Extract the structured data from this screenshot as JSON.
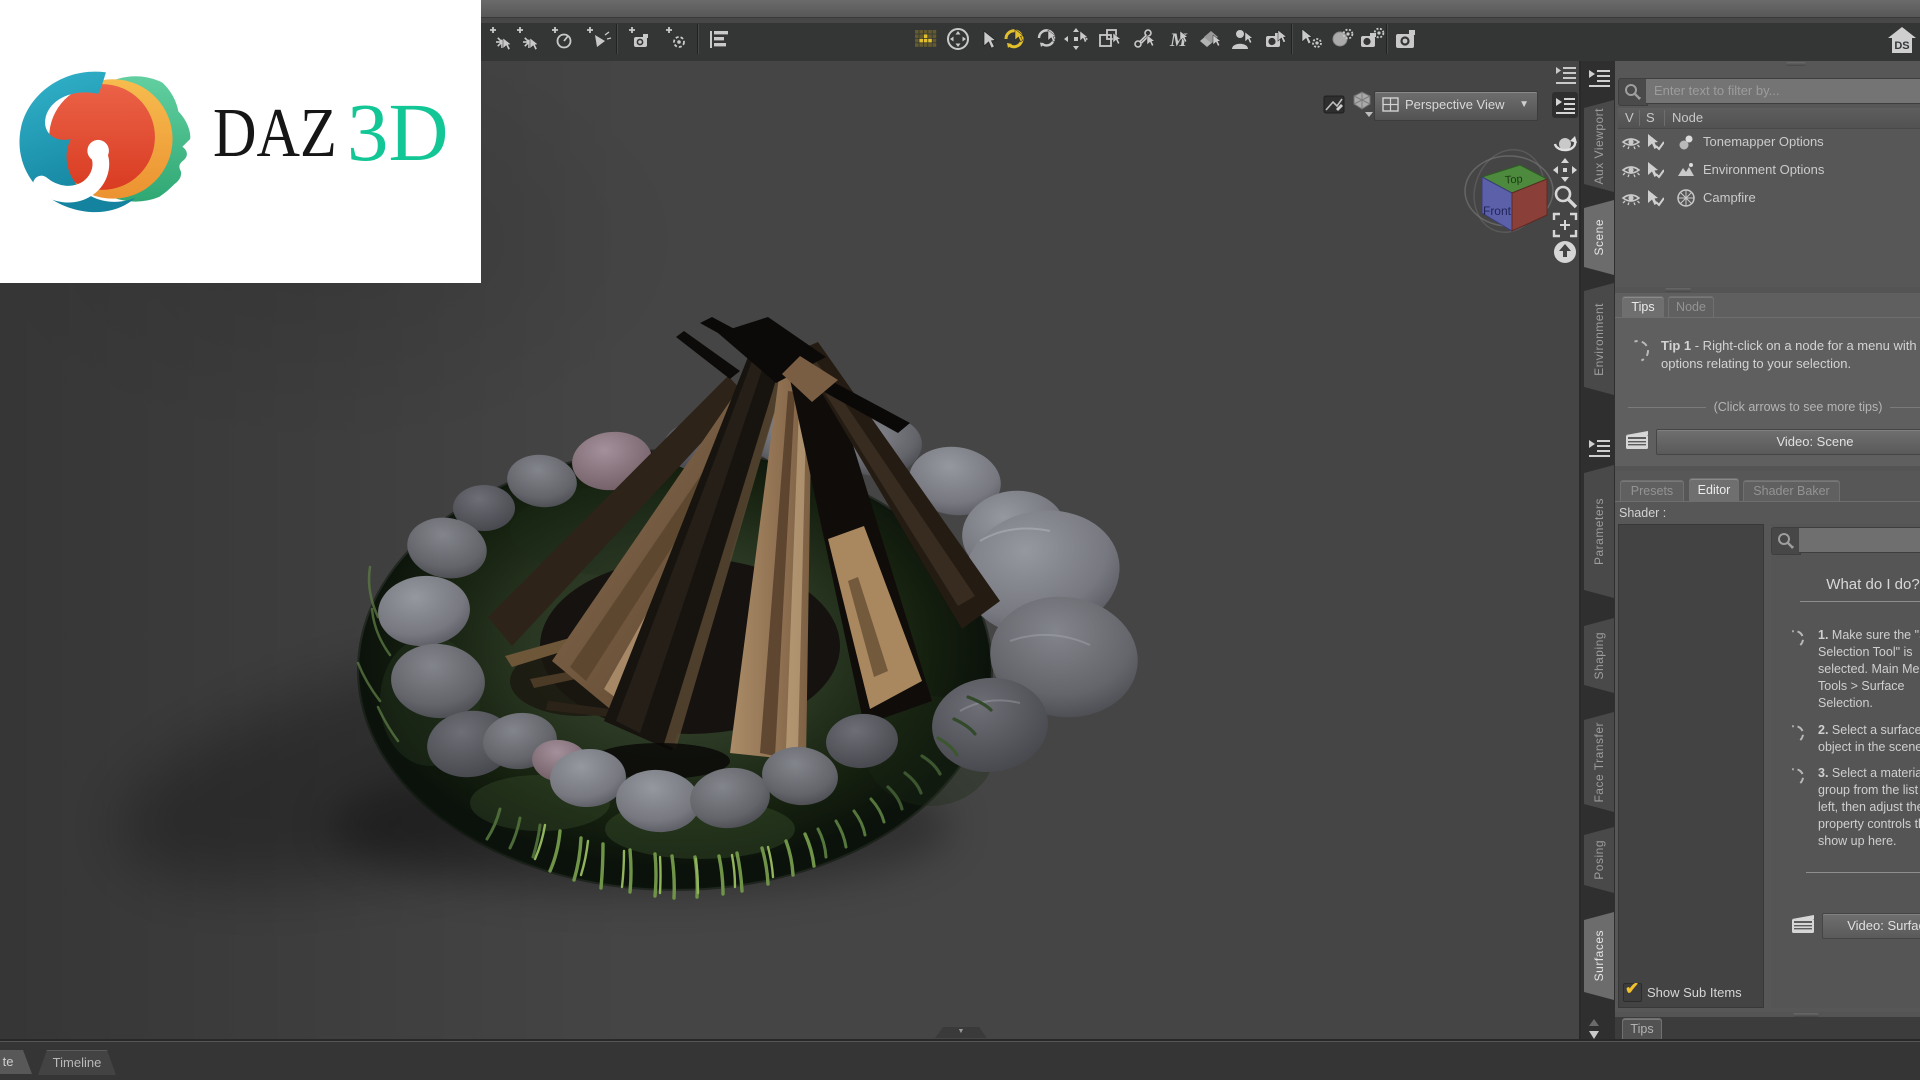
{
  "logo": {
    "brand": "DAZ",
    "suffix": "3D"
  },
  "home_badge": "DS",
  "toolbar": {
    "left_icons": [
      "spotlight-partial-icon",
      "create-point-light-icon",
      "create-sun-light-icon",
      "create-spotlight-icon",
      "create-camera-icon",
      "create-orbit-camera-icon",
      "view-options-icon"
    ],
    "tool_icons": [
      "scene-grid-icon",
      "universal-manipulator-icon",
      "node-selection-icon",
      "active-rotate-icon",
      "rotate-tool-icon",
      "translate-tool-icon",
      "scale-tool-icon",
      "joint-editor-icon",
      "geometry-editor-icon",
      "surface-selection-icon",
      "figure-setup-icon",
      "camera-selection-icon",
      "tool-settings-icon",
      "render-settings-icon",
      "camera-settings-icon",
      "render-icon"
    ]
  },
  "viewport": {
    "view_selector": "Perspective View",
    "cube_top": "Top",
    "cube_front": "Front"
  },
  "dock": {
    "side_tabs_top": [
      {
        "label": "Aux Viewport",
        "selected": false
      },
      {
        "label": "Scene",
        "selected": true
      },
      {
        "label": "Environment",
        "selected": false
      }
    ],
    "side_tabs_bottom": [
      {
        "label": "Parameters",
        "selected": false
      },
      {
        "label": "Shaping",
        "selected": false
      },
      {
        "label": "Face Transfer",
        "selected": false
      },
      {
        "label": "Posing",
        "selected": false
      },
      {
        "label": "Surfaces",
        "selected": true
      }
    ],
    "scene_pane": {
      "filter_placeholder": "Enter text to filter by...",
      "col_v": "V",
      "col_s": "S",
      "col_node": "Node",
      "nodes": [
        {
          "label": "Tonemapper Options",
          "icon": "tonemapper-icon"
        },
        {
          "label": "Environment Options",
          "icon": "environment-icon"
        },
        {
          "label": "Campfire",
          "icon": "geometry-cube-icon"
        }
      ]
    },
    "tips_pane": {
      "tab_tips": "Tips",
      "tab_node": "Node",
      "tip_title": "Tip 1",
      "tip_text": "- Right-click on a node for a menu with options relating to your selection.",
      "more_tips": "(Click arrows to see more tips)",
      "video_button": "Video: Scene"
    },
    "surfaces_pane": {
      "tab_presets": "Presets",
      "tab_editor": "Editor",
      "tab_shader_baker": "Shader Baker",
      "shader_label": "Shader :",
      "help_title": "What do I do?",
      "steps": [
        {
          "num": "1.",
          "lines": [
            "Make sure the \"Surface",
            "Selection Tool\" is",
            "selected. Main Menu :",
            "Tools > Surface",
            "Selection."
          ]
        },
        {
          "num": "2.",
          "lines": [
            "Select a surface by clicking an",
            "object in the scene."
          ]
        },
        {
          "num": "3.",
          "lines": [
            "Select a material",
            "group from the list on the",
            "left, then adjust the",
            "property controls that",
            "show up here."
          ]
        }
      ],
      "video_button": "Video: Surfaces",
      "show_sub_items": "Show Sub Items"
    },
    "bottom_tab": "Tips"
  },
  "bottom_bar": {
    "tab_partial": "te",
    "tab_timeline": "Timeline"
  }
}
